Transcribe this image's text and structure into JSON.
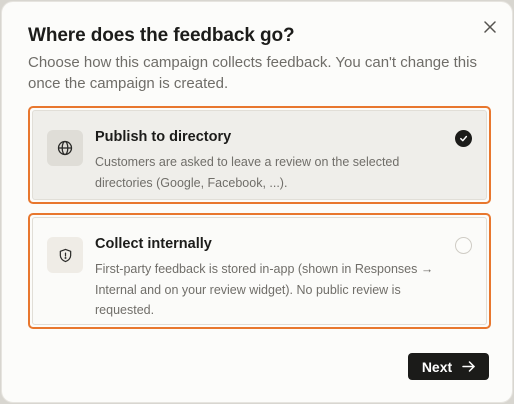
{
  "dialog": {
    "title": "Where does the feedback go?",
    "description": "Choose how this campaign collects feedback. You can't change this once the campaign is created.",
    "close_icon": "close-icon"
  },
  "options": [
    {
      "title": "Publish to directory",
      "description": "Customers are asked to leave a review on the selected directories (Google, Facebook, ...).",
      "icon": "globe-icon",
      "selected": true
    },
    {
      "title": "Collect internally",
      "description": "First-party feedback is stored in-app (shown in Responses → Internal and on your review widget). No public review is requested.",
      "icon": "shield-icon",
      "selected": false
    }
  ],
  "footer": {
    "next_label": "Next",
    "next_icon": "arrow-right-icon"
  },
  "colors": {
    "highlight_border": "#e8772e",
    "primary_button": "#1b1b19"
  }
}
